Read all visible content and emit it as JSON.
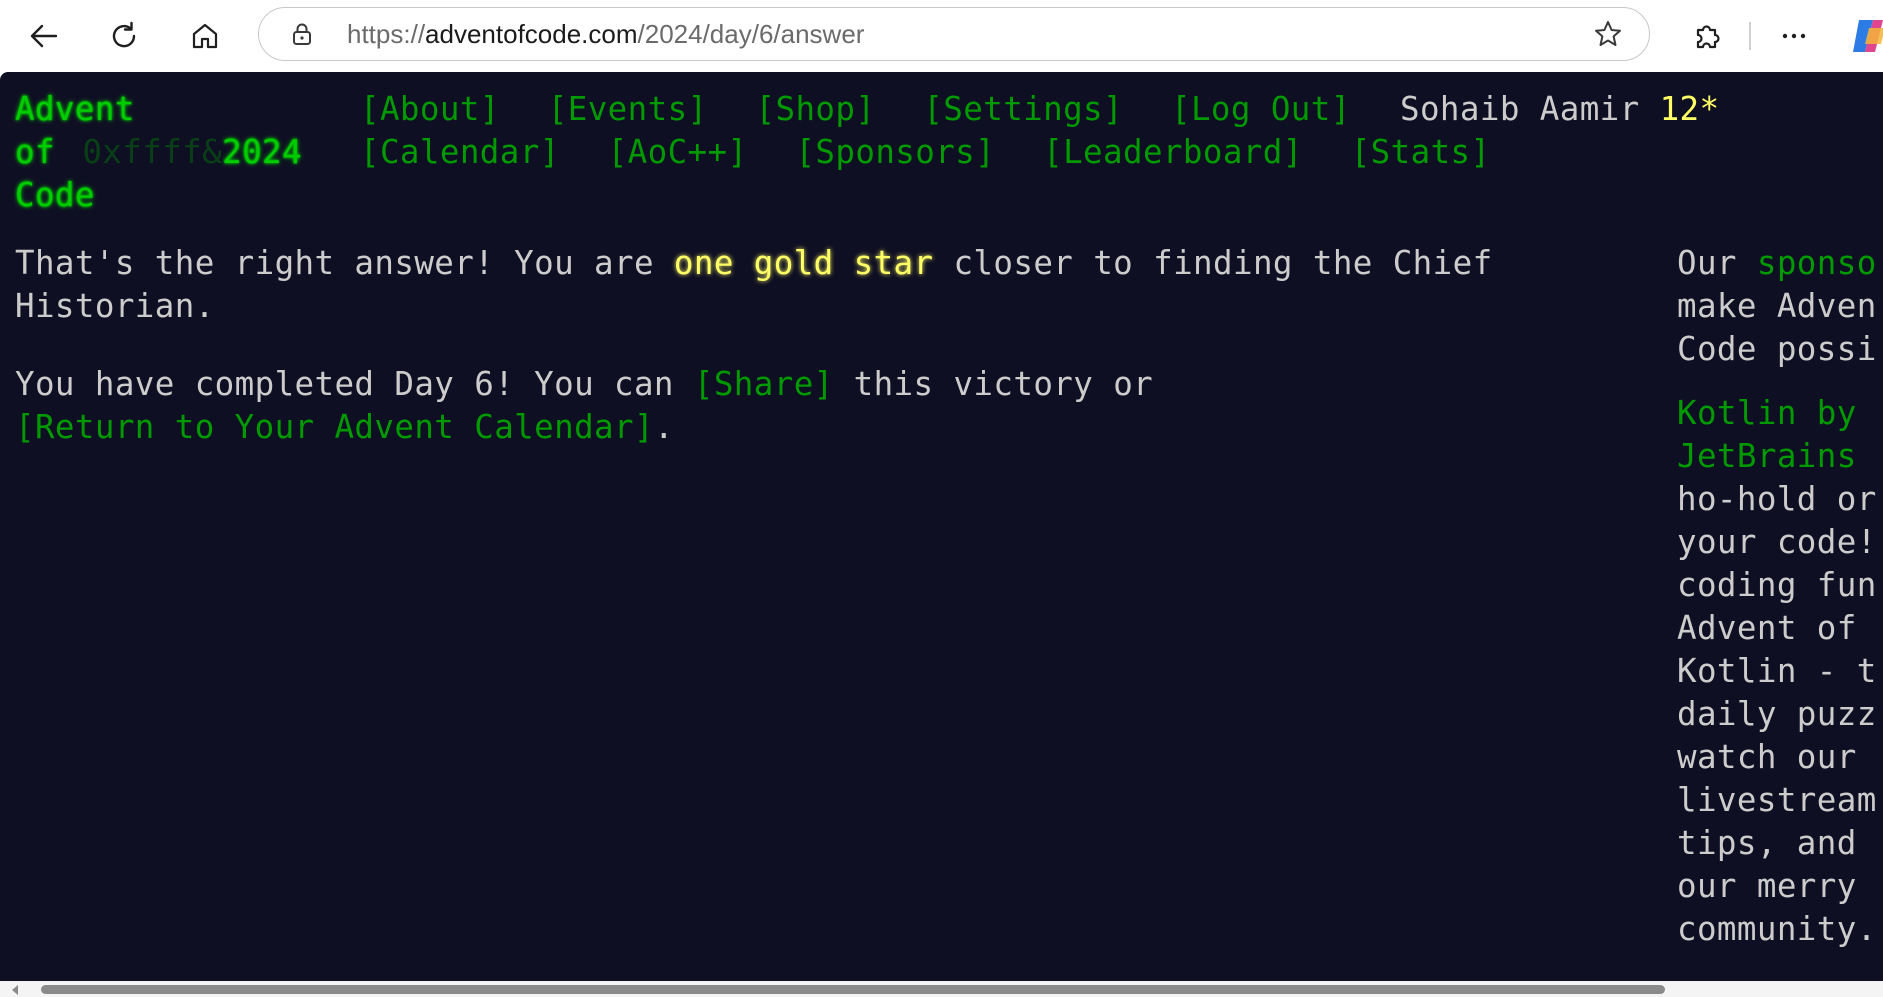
{
  "browser": {
    "url_prefix": "https://",
    "url_host": "adventofcode.com",
    "url_path": "/2024/day/6/answer",
    "icons": [
      "back-arrow-icon",
      "reload-icon",
      "home-icon",
      "lock-icon",
      "favorite-star-icon",
      "extensions-icon",
      "more-options-icon",
      "copilot-icon"
    ]
  },
  "header": {
    "site_title": "Advent of Code",
    "year_prefix": "0xffff&",
    "year": "2024",
    "nav_row1": [
      "[About]",
      "[Events]",
      "[Shop]",
      "[Settings]",
      "[Log Out]"
    ],
    "nav_row2": [
      "[Calendar]",
      "[AoC++]",
      "[Sponsors]",
      "[Leaderboard]",
      "[Stats]"
    ],
    "user_name": "Sohaib Aamir",
    "user_stars": "12*"
  },
  "main": {
    "line1_before": "That's the right answer! You are ",
    "line1_highlight": "one gold star",
    "line1_after": " closer to finding the Chief Historian.",
    "line2_before": "You have completed Day 6! You can ",
    "share_link": "[Share]",
    "line2_middle": " this victory or ",
    "return_link": "[Return to Your Advent Calendar]",
    "line2_end": "."
  },
  "sidebar": {
    "intro_before": "Our ",
    "intro_link": "sponso",
    "intro_lines": [
      "make Adven",
      "Code possi"
    ],
    "sponsor_link_lines": [
      "Kotlin by",
      "JetBrains"
    ],
    "sponsor_text_lines": [
      "ho-hold or",
      "your code!",
      "coding fun",
      "Advent of",
      "Kotlin - t",
      "daily puzz",
      "watch our",
      "livestream",
      "tips, and",
      "our merry",
      "community."
    ]
  },
  "colors": {
    "page_background": "#0f0f23",
    "text": "#cccccc",
    "link_green": "#009900",
    "title_green": "#00cc00",
    "gold": "#ffff66"
  }
}
